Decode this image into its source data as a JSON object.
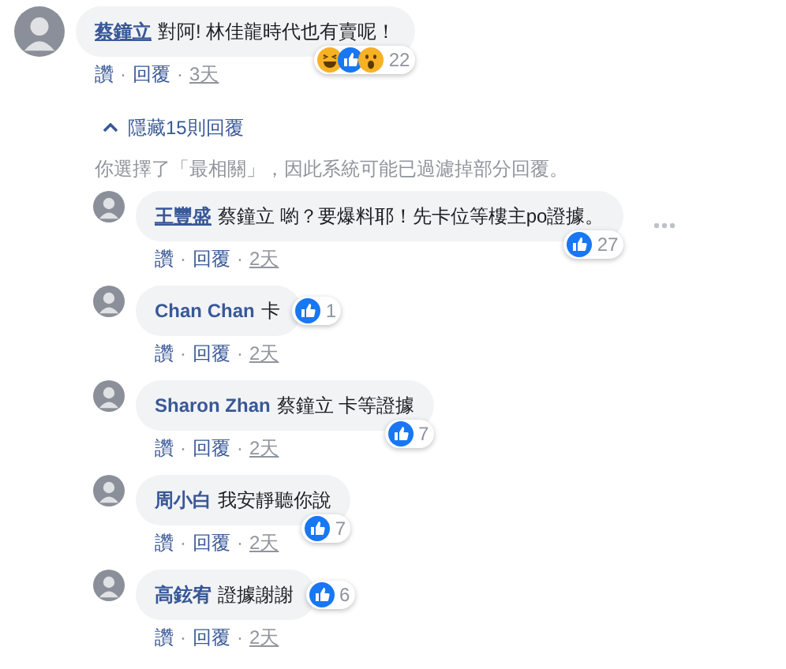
{
  "comment": {
    "author": "蔡鐘立",
    "author_underlined": true,
    "text": "對阿! 林佳龍時代也有賣呢！",
    "reaction_badge": {
      "kind": "bottom",
      "reactions": [
        {
          "kind": "haha"
        },
        {
          "kind": "like"
        },
        {
          "kind": "wow"
        }
      ],
      "count": "22"
    },
    "menu_visible": false,
    "actions": [
      {
        "kind": "link",
        "text": "讚"
      },
      {
        "kind": "dot",
        "text": "·"
      },
      {
        "kind": "link",
        "text": "回覆"
      },
      {
        "kind": "dot",
        "text": "·"
      },
      {
        "kind": "time",
        "text": "3天"
      }
    ]
  },
  "hide_replies": "隱藏15則回覆",
  "filter_note": "你選擇了「最相關」，因此系統可能已過濾掉部分回覆。",
  "replies": [
    {
      "author": "王豐盛",
      "author_underlined": true,
      "text": "蔡鐘立 喲？要爆料耶！先卡位等樓主po證據。",
      "reaction_badge": {
        "kind": "bottom",
        "reactions": [
          {
            "kind": "like"
          }
        ],
        "count": "27"
      },
      "menu_visible": true,
      "actions": [
        {
          "kind": "link",
          "text": "讚"
        },
        {
          "kind": "dot",
          "text": "·"
        },
        {
          "kind": "link",
          "text": "回覆"
        },
        {
          "kind": "dot",
          "text": "·"
        },
        {
          "kind": "time",
          "text": "2天"
        }
      ]
    },
    {
      "author": "Chan Chan",
      "author_underlined": false,
      "text": "卡",
      "reaction_badge": {
        "kind": "side",
        "reactions": [
          {
            "kind": "like"
          }
        ],
        "count": "1"
      },
      "menu_visible": false,
      "actions": [
        {
          "kind": "link",
          "text": "讚"
        },
        {
          "kind": "dot",
          "text": "·"
        },
        {
          "kind": "link",
          "text": "回覆"
        },
        {
          "kind": "dot",
          "text": "·"
        },
        {
          "kind": "time",
          "text": "2天"
        }
      ]
    },
    {
      "author": "Sharon Zhan",
      "author_underlined": false,
      "text": "蔡鐘立 卡等證據",
      "reaction_badge": {
        "kind": "bottom",
        "reactions": [
          {
            "kind": "like"
          }
        ],
        "count": "7"
      },
      "menu_visible": false,
      "actions": [
        {
          "kind": "link",
          "text": "讚"
        },
        {
          "kind": "dot",
          "text": "·"
        },
        {
          "kind": "link",
          "text": "回覆"
        },
        {
          "kind": "dot",
          "text": "·"
        },
        {
          "kind": "time",
          "text": "2天"
        }
      ]
    },
    {
      "author": "周小白",
      "author_underlined": false,
      "text": "我安靜聽你說",
      "reaction_badge": {
        "kind": "bottom",
        "reactions": [
          {
            "kind": "like"
          }
        ],
        "count": "7"
      },
      "menu_visible": false,
      "actions": [
        {
          "kind": "link",
          "text": "讚"
        },
        {
          "kind": "dot",
          "text": "·"
        },
        {
          "kind": "link",
          "text": "回覆"
        },
        {
          "kind": "dot",
          "text": "·"
        },
        {
          "kind": "time",
          "text": "2天"
        }
      ]
    },
    {
      "author": "高鉉宥",
      "author_underlined": false,
      "text": "證據謝謝",
      "reaction_badge": {
        "kind": "side",
        "reactions": [
          {
            "kind": "like"
          }
        ],
        "count": "6"
      },
      "menu_visible": false,
      "actions": [
        {
          "kind": "link",
          "text": "讚"
        },
        {
          "kind": "dot",
          "text": "·"
        },
        {
          "kind": "link",
          "text": "回覆"
        },
        {
          "kind": "dot",
          "text": "·"
        },
        {
          "kind": "time",
          "text": "2天"
        }
      ]
    }
  ]
}
